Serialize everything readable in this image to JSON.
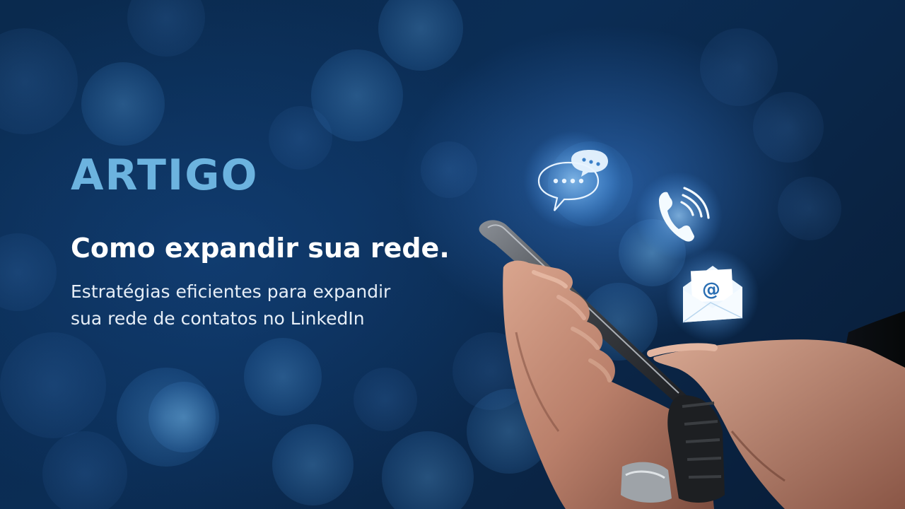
{
  "article": {
    "tag": "ARTIGO",
    "headline": "Como expandir sua rede.",
    "subtitle_line1": "Estratégias eficientes para expandir",
    "subtitle_line2": "sua rede de contatos no LinkedIn"
  },
  "icons": {
    "chat": "chat-bubbles-icon",
    "phone": "phone-icon",
    "email": "email-icon"
  },
  "colors": {
    "background": "#0b2d55",
    "accent": "#6cb3df",
    "headline": "#ffffff",
    "subtitle": "#e6eef7",
    "icon_glow": "#bfe3ff"
  }
}
